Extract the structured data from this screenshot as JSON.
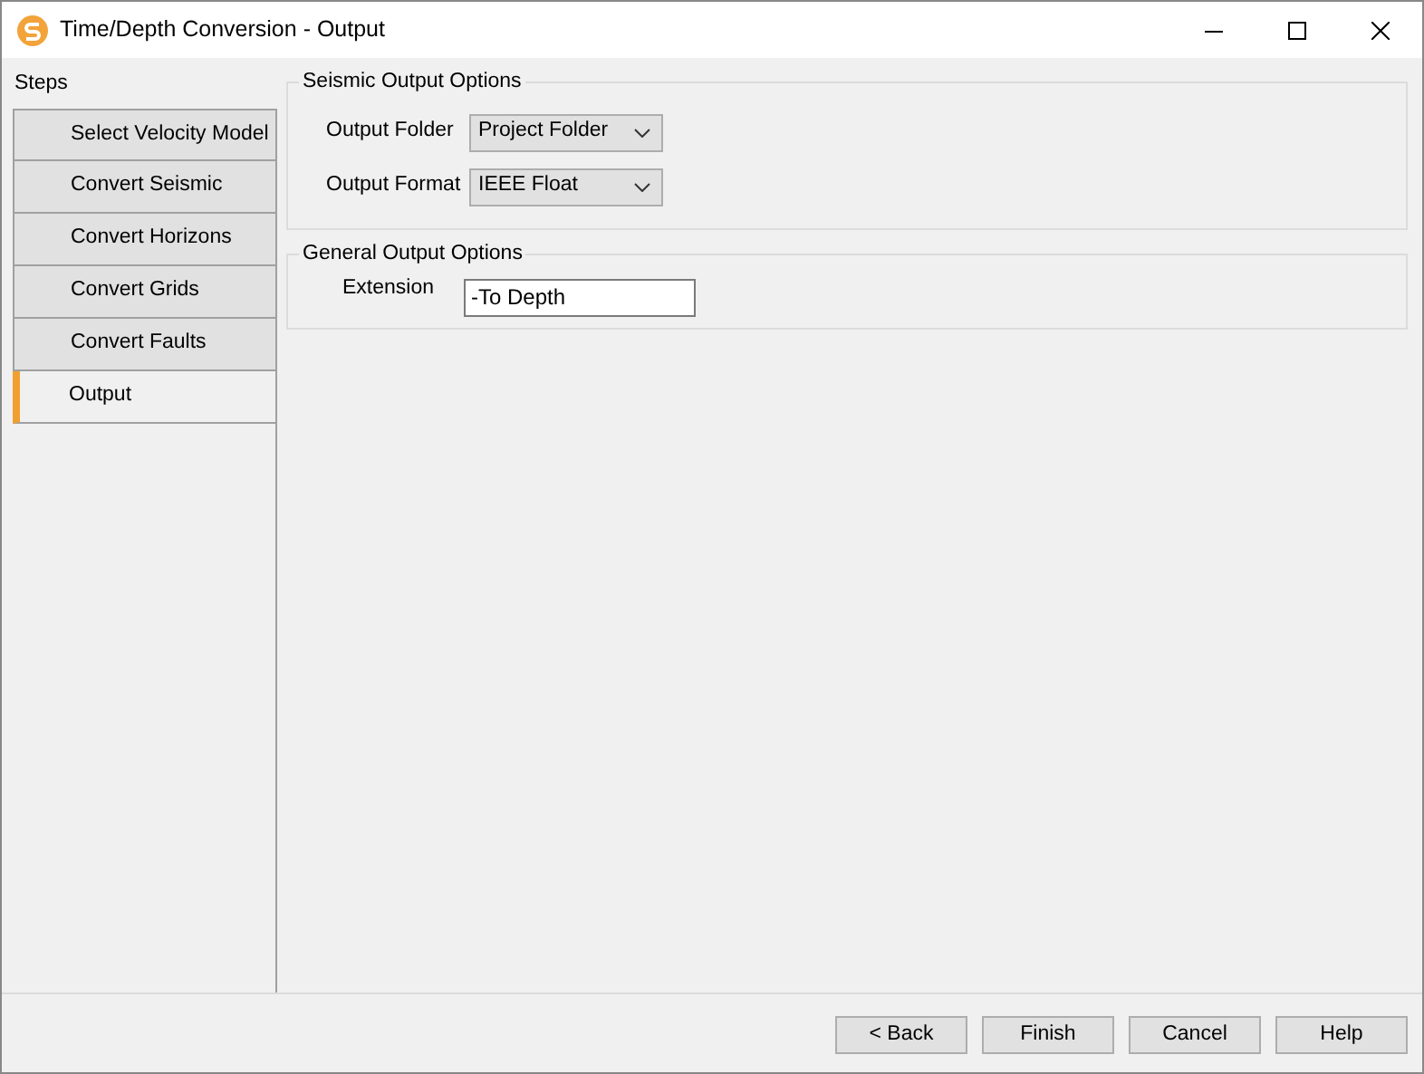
{
  "window": {
    "title": "Time/Depth Conversion - Output"
  },
  "steps": {
    "heading": "Steps",
    "items": [
      {
        "label": "Select Velocity Model",
        "selected": false
      },
      {
        "label": "Convert Seismic",
        "selected": false
      },
      {
        "label": "Convert Horizons",
        "selected": false
      },
      {
        "label": "Convert Grids",
        "selected": false
      },
      {
        "label": "Convert Faults",
        "selected": false
      },
      {
        "label": "Output",
        "selected": true
      }
    ]
  },
  "groups": [
    {
      "title": "Seismic Output Options",
      "fields": [
        {
          "kind": "dropdown",
          "label": "Output Folder",
          "value": "Project Folder"
        },
        {
          "kind": "dropdown",
          "label": "Output Format",
          "value": "IEEE Float"
        }
      ]
    },
    {
      "title": "General Output Options",
      "fields": [
        {
          "kind": "text",
          "label": "Extension",
          "value": "-To Depth"
        }
      ]
    }
  ],
  "buttons": [
    "< Back",
    "Finish",
    "Cancel",
    "Help"
  ]
}
